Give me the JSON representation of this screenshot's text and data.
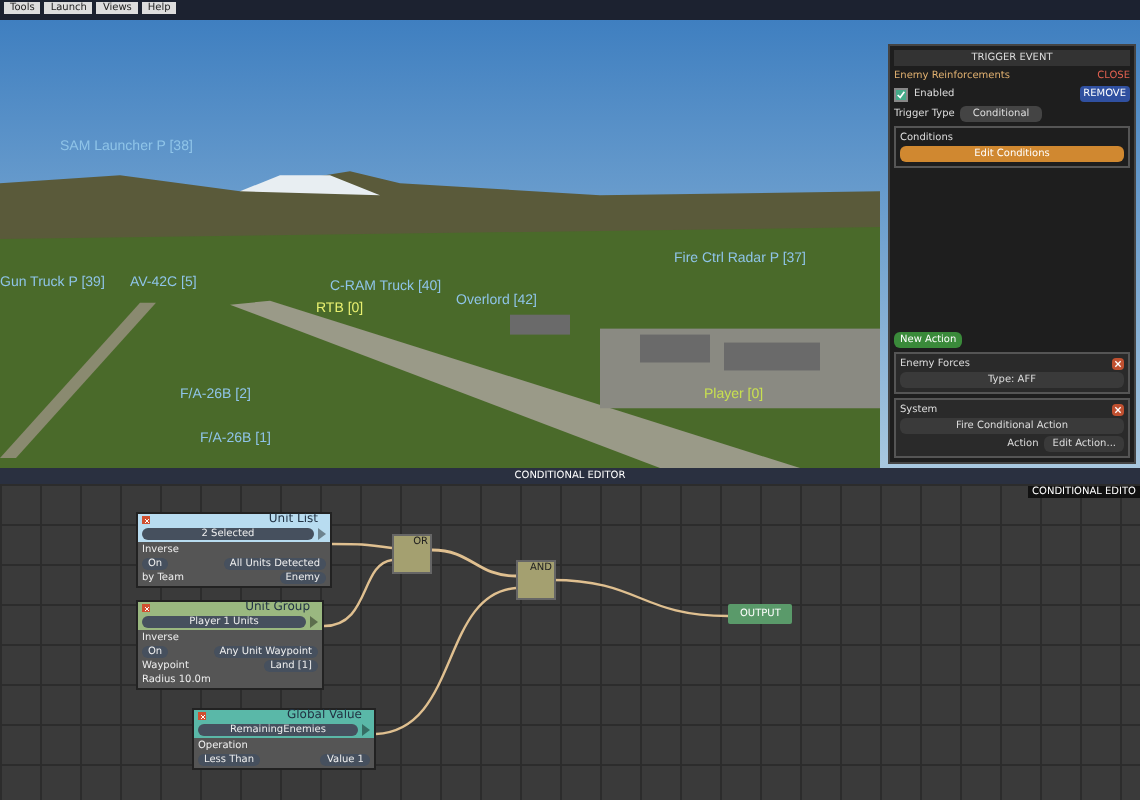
{
  "menu": [
    {
      "label": "Tools"
    },
    {
      "label": "Launch"
    },
    {
      "label": "Views"
    },
    {
      "label": "Help"
    }
  ],
  "scene": {
    "labels": [
      {
        "text": "SAM Launcher P [38]",
        "color": "#8fc4e8"
      },
      {
        "text": "Gun Truck P [39]",
        "color": "#8fc4e8"
      },
      {
        "text": "AV-42C [5]",
        "color": "#8fc4e8"
      },
      {
        "text": "C-RAM Truck [40]",
        "color": "#8fc4e8"
      },
      {
        "text": "Overlord [42]",
        "color": "#8fc4e8"
      },
      {
        "text": "RTB [0]",
        "color": "#e8f070"
      },
      {
        "text": "Fire Ctrl Radar P [37]",
        "color": "#8fc4e8"
      },
      {
        "text": "F/A-26B [2]",
        "color": "#8fc4e8"
      },
      {
        "text": "F/A-26B [1]",
        "color": "#8fc4e8"
      },
      {
        "text": "Player [0]",
        "color": "#c8e050"
      }
    ]
  },
  "panel": {
    "title": "TRIGGER EVENT",
    "event_name": "Enemy Reinforcements",
    "enabled": {
      "label": "Enabled",
      "checked": true
    },
    "trigger_type_label": "Trigger Type",
    "trigger_type": "Conditional",
    "close": "CLOSE",
    "remove": "REMOVE",
    "conditions_label": "Conditions",
    "edit_conditions": "Edit Conditions",
    "new_action": "New Action",
    "actions": [
      {
        "title": "Enemy Forces",
        "button": "Type: AFF"
      },
      {
        "title": "System",
        "button": "Fire Conditional Action",
        "extra_label": "Action",
        "extra_button": "Edit Action..."
      }
    ]
  },
  "editor": {
    "title": "CONDITIONAL EDITOR",
    "side_title": "CONDITIONAL EDITO",
    "nodes": [
      {
        "kind": "source",
        "title": "Unit List",
        "color": "#b8dcf0",
        "value": "2 Selected",
        "section": "Inverse",
        "rows": [
          [
            {
              "kind": "field",
              "text": "On"
            },
            {
              "kind": "field",
              "text": "All Units Detected"
            }
          ],
          [
            {
              "kind": "label",
              "text": "by Team"
            },
            {
              "kind": "field",
              "text": "Enemy"
            }
          ]
        ]
      },
      {
        "kind": "source",
        "title": "Unit Group",
        "color": "#9ab880",
        "value": "Player 1 Units",
        "section": "Inverse",
        "rows": [
          [
            {
              "kind": "field",
              "text": "On"
            },
            {
              "kind": "field",
              "text": "Any Unit Waypoint"
            }
          ],
          [
            {
              "kind": "label",
              "text": "Waypoint"
            },
            {
              "kind": "field",
              "text": "Land [1]"
            }
          ],
          [
            {
              "kind": "label",
              "text": "Radius 10.0m"
            }
          ]
        ]
      },
      {
        "kind": "gate",
        "title": "OR"
      },
      {
        "kind": "gate",
        "title": "AND"
      },
      {
        "kind": "output",
        "title": "OUTPUT"
      },
      {
        "kind": "source",
        "title": "Global Value",
        "color": "#5ab8a8",
        "value": "RemainingEnemies",
        "section": "Operation",
        "rows": [
          [
            {
              "kind": "field",
              "text": "Less Than"
            },
            {
              "kind": "field",
              "text": "Value 1"
            }
          ]
        ]
      }
    ]
  }
}
